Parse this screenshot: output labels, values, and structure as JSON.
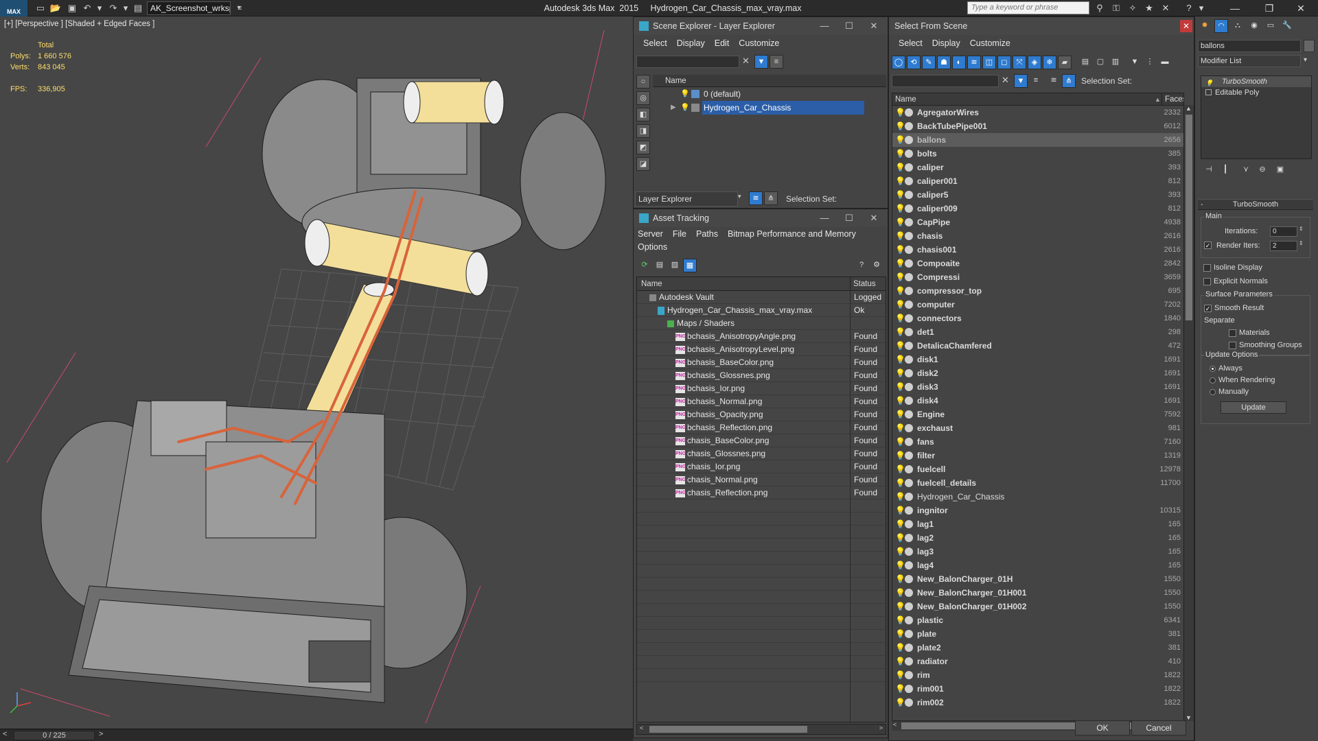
{
  "app": {
    "logo_text": "MAX",
    "workspace": "AK_Screenshot_wrksp",
    "title": "Autodesk 3ds Max  2015     Hydrogen_Car_Chassis_max_vray.max",
    "search_placeholder": "Type a keyword or phrase"
  },
  "viewport": {
    "label": "[+] [Perspective ] [Shaded + Edged Faces ]",
    "stats_total_label": "Total",
    "polys_label": "Polys:",
    "polys_value": "1 660 576",
    "verts_label": "Verts:",
    "verts_value": "843 045",
    "fps_label": "FPS:",
    "fps_value": "336,905",
    "time_slider": "0 / 225"
  },
  "scene_explorer": {
    "title": "Scene Explorer - Layer Explorer",
    "menu": [
      "Select",
      "Display",
      "Edit",
      "Customize"
    ],
    "col_name": "Name",
    "layers": [
      "0 (default)",
      "Hydrogen_Car_Chassis"
    ],
    "footer_label": "Layer Explorer",
    "selection_set_label": "Selection Set:"
  },
  "asset_tracking": {
    "title": "Asset Tracking",
    "menu": [
      "Server",
      "File",
      "Paths",
      "Bitmap Performance and Memory"
    ],
    "menu2": "Options",
    "col_name": "Name",
    "col_status": "Status",
    "rows": [
      {
        "name": "Autodesk Vault",
        "status": "Logged"
      },
      {
        "name": "Hydrogen_Car_Chassis_max_vray.max",
        "status": "Ok"
      },
      {
        "name": "Maps / Shaders",
        "status": ""
      },
      {
        "name": "bchasis_AnisotropyAngle.png",
        "status": "Found"
      },
      {
        "name": "bchasis_AnisotropyLevel.png",
        "status": "Found"
      },
      {
        "name": "bchasis_BaseColor.png",
        "status": "Found"
      },
      {
        "name": "bchasis_Glossnes.png",
        "status": "Found"
      },
      {
        "name": "bchasis_Ior.png",
        "status": "Found"
      },
      {
        "name": "bchasis_Normal.png",
        "status": "Found"
      },
      {
        "name": "bchasis_Opacity.png",
        "status": "Found"
      },
      {
        "name": "bchasis_Reflection.png",
        "status": "Found"
      },
      {
        "name": "chasis_BaseColor.png",
        "status": "Found"
      },
      {
        "name": "chasis_Glossnes.png",
        "status": "Found"
      },
      {
        "name": "chasis_Ior.png",
        "status": "Found"
      },
      {
        "name": "chasis_Normal.png",
        "status": "Found"
      },
      {
        "name": "chasis_Reflection.png",
        "status": "Found"
      }
    ]
  },
  "select_from_scene": {
    "title": "Select From Scene",
    "menu": [
      "Select",
      "Display",
      "Customize"
    ],
    "selection_set_label": "Selection Set:",
    "col_name": "Name",
    "col_faces": "Faces",
    "selected": "ballons",
    "items": [
      {
        "name": "AgregatorWires",
        "faces": "2332"
      },
      {
        "name": "BackTubePipe001",
        "faces": "6012"
      },
      {
        "name": "ballons",
        "faces": "2656"
      },
      {
        "name": "bolts",
        "faces": "385"
      },
      {
        "name": "caliper",
        "faces": "393"
      },
      {
        "name": "caliper001",
        "faces": "812"
      },
      {
        "name": "caliper5",
        "faces": "393"
      },
      {
        "name": "caliper009",
        "faces": "812"
      },
      {
        "name": "CapPipe",
        "faces": "4938"
      },
      {
        "name": "chasis",
        "faces": "2616"
      },
      {
        "name": "chasis001",
        "faces": "2616"
      },
      {
        "name": "Compoaite",
        "faces": "2842"
      },
      {
        "name": "Compressi",
        "faces": "3659"
      },
      {
        "name": "compressor_top",
        "faces": "695"
      },
      {
        "name": "computer",
        "faces": "7202"
      },
      {
        "name": "connectors",
        "faces": "1840"
      },
      {
        "name": "det1",
        "faces": "298"
      },
      {
        "name": "DetalicaChamfered",
        "faces": "472"
      },
      {
        "name": "disk1",
        "faces": "1691"
      },
      {
        "name": "disk2",
        "faces": "1691"
      },
      {
        "name": "disk3",
        "faces": "1691"
      },
      {
        "name": "disk4",
        "faces": "1691"
      },
      {
        "name": "Engine",
        "faces": "7592"
      },
      {
        "name": "exchaust",
        "faces": "981"
      },
      {
        "name": "fans",
        "faces": "7160"
      },
      {
        "name": "filter",
        "faces": "1319"
      },
      {
        "name": "fuelcell",
        "faces": "12978"
      },
      {
        "name": "fuelcell_details",
        "faces": "11700"
      },
      {
        "name": "Hydrogen_Car_Chassis",
        "faces": ""
      },
      {
        "name": "ingnitor",
        "faces": "10315"
      },
      {
        "name": "lag1",
        "faces": "165"
      },
      {
        "name": "lag2",
        "faces": "165"
      },
      {
        "name": "lag3",
        "faces": "165"
      },
      {
        "name": "lag4",
        "faces": "165"
      },
      {
        "name": "New_BalonCharger_01H",
        "faces": "1550"
      },
      {
        "name": "New_BalonCharger_01H001",
        "faces": "1550"
      },
      {
        "name": "New_BalonCharger_01H002",
        "faces": "1550"
      },
      {
        "name": "plastic",
        "faces": "6341"
      },
      {
        "name": "plate",
        "faces": "381"
      },
      {
        "name": "plate2",
        "faces": "381"
      },
      {
        "name": "radiator",
        "faces": "410"
      },
      {
        "name": "rim",
        "faces": "1822"
      },
      {
        "name": "rim001",
        "faces": "1822"
      },
      {
        "name": "rim002",
        "faces": "1822"
      }
    ],
    "ok": "OK",
    "cancel": "Cancel"
  },
  "modifier_panel": {
    "object_name": "ballons",
    "modifier_list": "Modifier List",
    "stack": [
      "TurboSmooth",
      "Editable Poly"
    ],
    "rollout_title": "TurboSmooth",
    "main_group": "Main",
    "iterations_label": "Iterations:",
    "iterations_value": "0",
    "render_iters_label": "Render Iters:",
    "render_iters_value": "2",
    "isoline_label": "Isoline Display",
    "explicit_normals_label": "Explicit Normals",
    "surface_group": "Surface Parameters",
    "smooth_result_label": "Smooth Result",
    "separate_label": "Separate",
    "materials_label": "Materials",
    "smoothing_groups_label": "Smoothing Groups",
    "update_group": "Update Options",
    "always_label": "Always",
    "when_rendering_label": "When Rendering",
    "manually_label": "Manually",
    "update_button": "Update"
  },
  "colors": {
    "selected_row": "#2b5ea7",
    "accent": "#2e7bcf",
    "fuel_tank": "#f3df9a",
    "pipe": "#d9633a"
  }
}
